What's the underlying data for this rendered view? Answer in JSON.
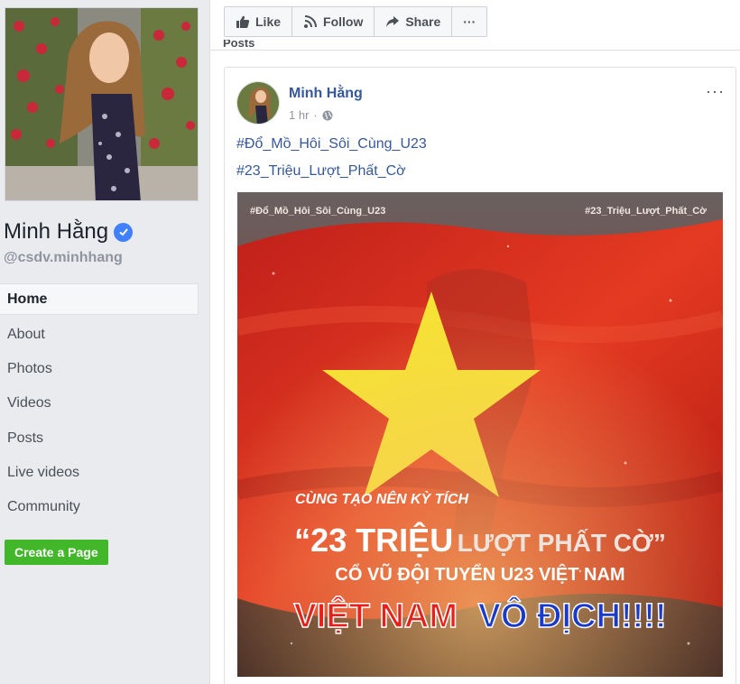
{
  "profile": {
    "name": "Minh Hằng",
    "handle": "@csdv.minhhang"
  },
  "nav": {
    "items": [
      "Home",
      "About",
      "Photos",
      "Videos",
      "Posts",
      "Live videos",
      "Community"
    ],
    "create_page": "Create a Page"
  },
  "actions": {
    "like": "Like",
    "follow": "Follow",
    "share": "Share",
    "more": "···"
  },
  "section_peek": "Posts",
  "post": {
    "author": "Minh Hằng",
    "time": "1 hr",
    "more": "···",
    "hashtags": [
      "#Đổ_Mồ_Hôi_Sôi_Cùng_U23",
      "#23_Triệu_Lượt_Phất_Cờ"
    ],
    "image": {
      "tag_left": "#Đổ_Mồ_Hôi_Sôi_Cùng_U23",
      "tag_right": "#23_Triệu_Lượt_Phất_Cờ",
      "line1": "CÙNG TẠO NÊN KỲ TÍCH",
      "line2a": "“23 TRIỆU",
      "line2b": "LƯỢT PHẤT CỜ”",
      "line3": "CỔ VŨ ĐỘI TUYỂN U23 VIỆT NAM",
      "line4a": "VIỆT NAM",
      "line4b": "VÔ ĐỊCH!!!!"
    }
  },
  "colors": {
    "link": "#365899",
    "verified": "#4080ff",
    "create_button": "#42b72a",
    "flag_red": "#d8241a",
    "star_yellow": "#f6e135"
  }
}
